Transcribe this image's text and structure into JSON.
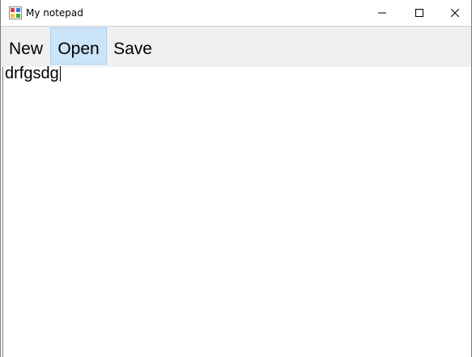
{
  "window": {
    "title": "My notepad",
    "icon": "winforms-app-icon",
    "controls": {
      "minimize_icon": "minimize-icon",
      "maximize_icon": "maximize-icon",
      "close_icon": "close-icon"
    }
  },
  "menu": {
    "items": [
      {
        "label": "New",
        "state": "normal"
      },
      {
        "label": "Open",
        "state": "hover"
      },
      {
        "label": "Save",
        "state": "normal"
      }
    ],
    "background": "#f0f0f0",
    "hover_background": "#cce4f7",
    "hover_border": "#a8d0f0"
  },
  "editor": {
    "text": "drfgsdg"
  }
}
